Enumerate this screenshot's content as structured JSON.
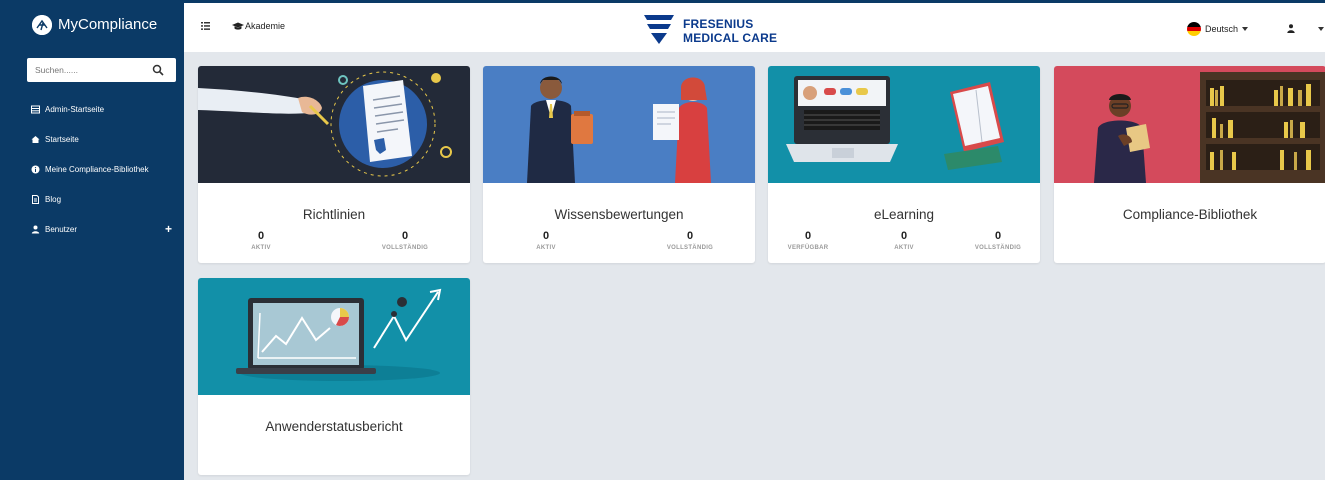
{
  "sidebar": {
    "brand": "MyCompliance",
    "search_placeholder": "Suchen......",
    "items": [
      {
        "label": "Admin-Startseite",
        "icon": "table-icon"
      },
      {
        "label": "Startseite",
        "icon": "home-icon"
      },
      {
        "label": "Meine Compliance-Bibliothek",
        "icon": "info-icon"
      },
      {
        "label": "Blog",
        "icon": "document-icon"
      },
      {
        "label": "Benutzer",
        "icon": "user-icon",
        "expand": "+"
      }
    ]
  },
  "topbar": {
    "menu_icon": "list-icon",
    "akademie": "Akademie",
    "logo_line1": "FRESENIUS",
    "logo_line2": "MEDICAL CARE",
    "language": "Deutsch",
    "accent": "#0b3a66"
  },
  "cards": [
    {
      "title": "Richtlinien",
      "color": "#1f2a3a",
      "stats": [
        {
          "value": "0",
          "label": "AKTIV"
        },
        {
          "value": "0",
          "label": "VOLLSTÄNDIG"
        }
      ]
    },
    {
      "title": "Wissensbewertungen",
      "color": "#4a7ec4",
      "stats": [
        {
          "value": "0",
          "label": "AKTIV"
        },
        {
          "value": "0",
          "label": "VOLLSTÄNDIG"
        }
      ]
    },
    {
      "title": "eLearning",
      "color": "#1290a8",
      "stats": [
        {
          "value": "0",
          "label": "VERFÜGBAR"
        },
        {
          "value": "0",
          "label": "AKTIV"
        },
        {
          "value": "0",
          "label": "VOLLSTÄNDIG"
        }
      ]
    },
    {
      "title": "Compliance-Bibliothek",
      "color": "#d44a5c",
      "stats": []
    },
    {
      "title": "Anwenderstatusbericht",
      "color": "#1290a8",
      "stats": []
    }
  ]
}
